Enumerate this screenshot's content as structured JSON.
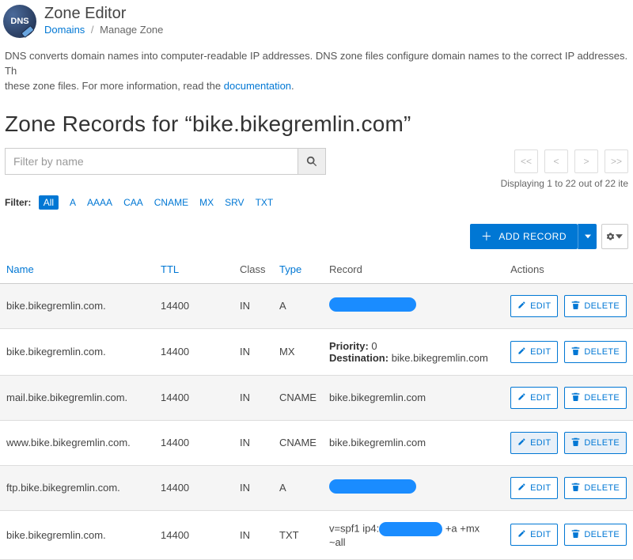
{
  "header": {
    "app_icon_text": "DNS",
    "title": "Zone Editor",
    "breadcrumb": {
      "domains": "Domains",
      "current": "Manage Zone"
    }
  },
  "intro": {
    "text_a": "DNS converts domain names into computer-readable IP addresses. DNS zone files configure domain names to the correct IP addresses. Th",
    "text_b": "these zone files. For more information, read the ",
    "doc_link": "documentation",
    "text_c": "."
  },
  "heading": "Zone Records for “bike.bikegremlin.com”",
  "search": {
    "placeholder": "Filter by name"
  },
  "pagination": {
    "first": "<<",
    "prev": "<",
    "next": ">",
    "last": ">>",
    "displaying": "Displaying 1 to 22 out of 22 ite"
  },
  "filters": {
    "label": "Filter:",
    "items": [
      "All",
      "A",
      "AAAA",
      "CAA",
      "CNAME",
      "MX",
      "SRV",
      "TXT"
    ],
    "active": "All"
  },
  "toolbar": {
    "add_record": "ADD RECORD"
  },
  "columns": {
    "name": "Name",
    "ttl": "TTL",
    "class": "Class",
    "type": "Type",
    "record": "Record",
    "actions": "Actions"
  },
  "actions": {
    "edit": "EDIT",
    "delete": "DELETE"
  },
  "rows": [
    {
      "name": "bike.bikegremlin.com.",
      "ttl": "14400",
      "class": "IN",
      "type": "A",
      "record_kind": "redacted"
    },
    {
      "name": "bike.bikegremlin.com.",
      "ttl": "14400",
      "class": "IN",
      "type": "MX",
      "record_kind": "kv",
      "priority_label": "Priority:",
      "priority_value": "0",
      "dest_label": "Destination:",
      "dest_value": "bike.bikegremlin.com"
    },
    {
      "name": "mail.bike.bikegremlin.com.",
      "ttl": "14400",
      "class": "IN",
      "type": "CNAME",
      "record_kind": "text",
      "record_text": "bike.bikegremlin.com"
    },
    {
      "name": "www.bike.bikegremlin.com.",
      "ttl": "14400",
      "class": "IN",
      "type": "CNAME",
      "record_kind": "text",
      "record_text": "bike.bikegremlin.com",
      "pressed": true
    },
    {
      "name": "ftp.bike.bikegremlin.com.",
      "ttl": "14400",
      "class": "IN",
      "type": "A",
      "record_kind": "redacted"
    },
    {
      "name": "bike.bikegremlin.com.",
      "ttl": "14400",
      "class": "IN",
      "type": "TXT",
      "record_kind": "spf",
      "spf_a": "v=spf1 ip4:",
      "spf_b": "+a +mx ~all"
    }
  ]
}
